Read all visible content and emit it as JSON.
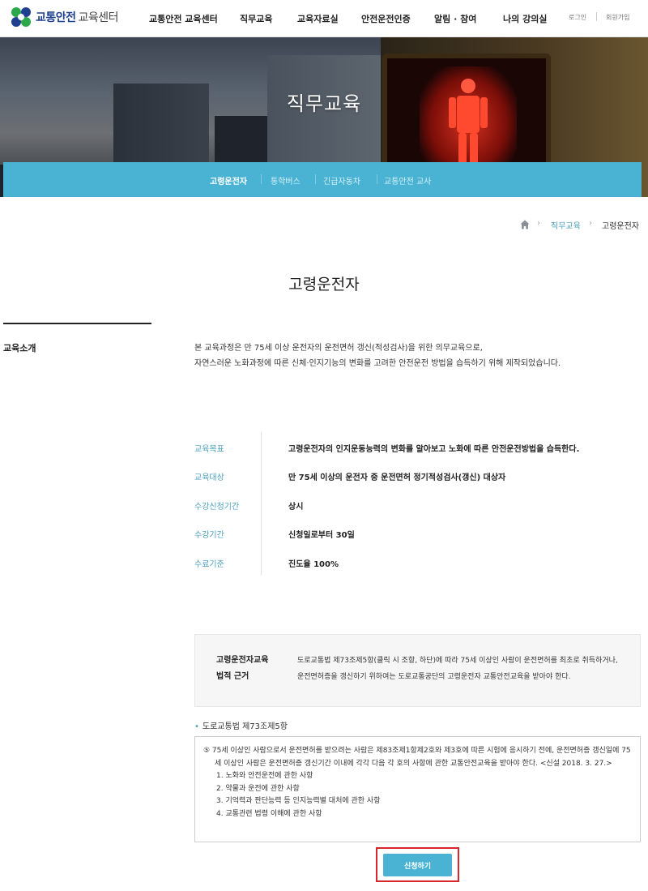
{
  "header": {
    "logo_bold": "교통안전",
    "logo_sub": "교육센터",
    "menu": [
      "교통안전 교육센터",
      "직무교육",
      "교육자료실",
      "안전운전인증",
      "알림 · 참여",
      "나의 강의실"
    ],
    "login": "로그인",
    "signup": "회원가입"
  },
  "hero": {
    "title": "직무교육",
    "tabs": [
      "고령운전자",
      "통학버스",
      "긴급자동차",
      "교통안전 교사"
    ]
  },
  "breadcrumb": [
    "직무교육",
    "고령운전자"
  ],
  "page_title": "고령운전자",
  "sidebar": {
    "label": "교육소개"
  },
  "intro": [
    "본 교육과정은 만 75세 이상 운전자의 운전면허 갱신(적성검사)을 위한 의무교육으로,",
    "자연스러운 노화과정에 따른 신체·인지기능의 변화를 고려한 안전운전 방법을 습득하기 위해 제작되었습니다."
  ],
  "info": [
    {
      "label": "교육목표",
      "value": "고령운전자의 인지운동능력의 변화를 알아보고 노화에 따른 안전운전방법을 습득한다."
    },
    {
      "label": "교육대상",
      "value": "만 75세 이상의 운전자 중 운전면허 정기적성검사(갱신) 대상자"
    },
    {
      "label": "수강신청기간",
      "value": "상시"
    },
    {
      "label": "수강기간",
      "value": "신청일로부터 30일"
    },
    {
      "label": "수료기준",
      "value": "진도율 100%"
    }
  ],
  "law": {
    "title_line1": "고령운전자교육",
    "title_line2": "법적 근거",
    "text": "도로교통법 제73조제5항(클릭 시 조항, 하단)에 따라 75세 이상인 사람이 운전면허를 최초로 취득하거나, 운전면허증을 갱신하기 위하여는 도로교통공단의 고령운전자 교통안전교육을 받아야 한다."
  },
  "reference": {
    "heading": "도로교통법 제73조제5항",
    "paragraph": "⑤  75세 이상인 사람으로서 운전면허를 받으려는 사람은 제83조제1항제2호와 제3호에 따른 시험에 응시하기 전에, 운전면허증 갱신일에 75세 이상인 사람은 운전면허증 갱신기간 이내에 각각 다음 각 호의 사항에 관한 교통안전교육을 받아야 한다. <신설 2018. 3. 27.>",
    "items": [
      "1.  노화와 안전운전에 관한 사항",
      "2.  약물과 운전에 관한 사항",
      "3.  기억력과 판단능력 등 인지능력별 대처에 관한 사항",
      "4.  교통관련 법령 이해에 관한 사항"
    ]
  },
  "apply_button": "신청하기",
  "colors": {
    "accent": "#4ab3d4",
    "highlight": "#d9262a",
    "brand": "#1f3f8f"
  }
}
